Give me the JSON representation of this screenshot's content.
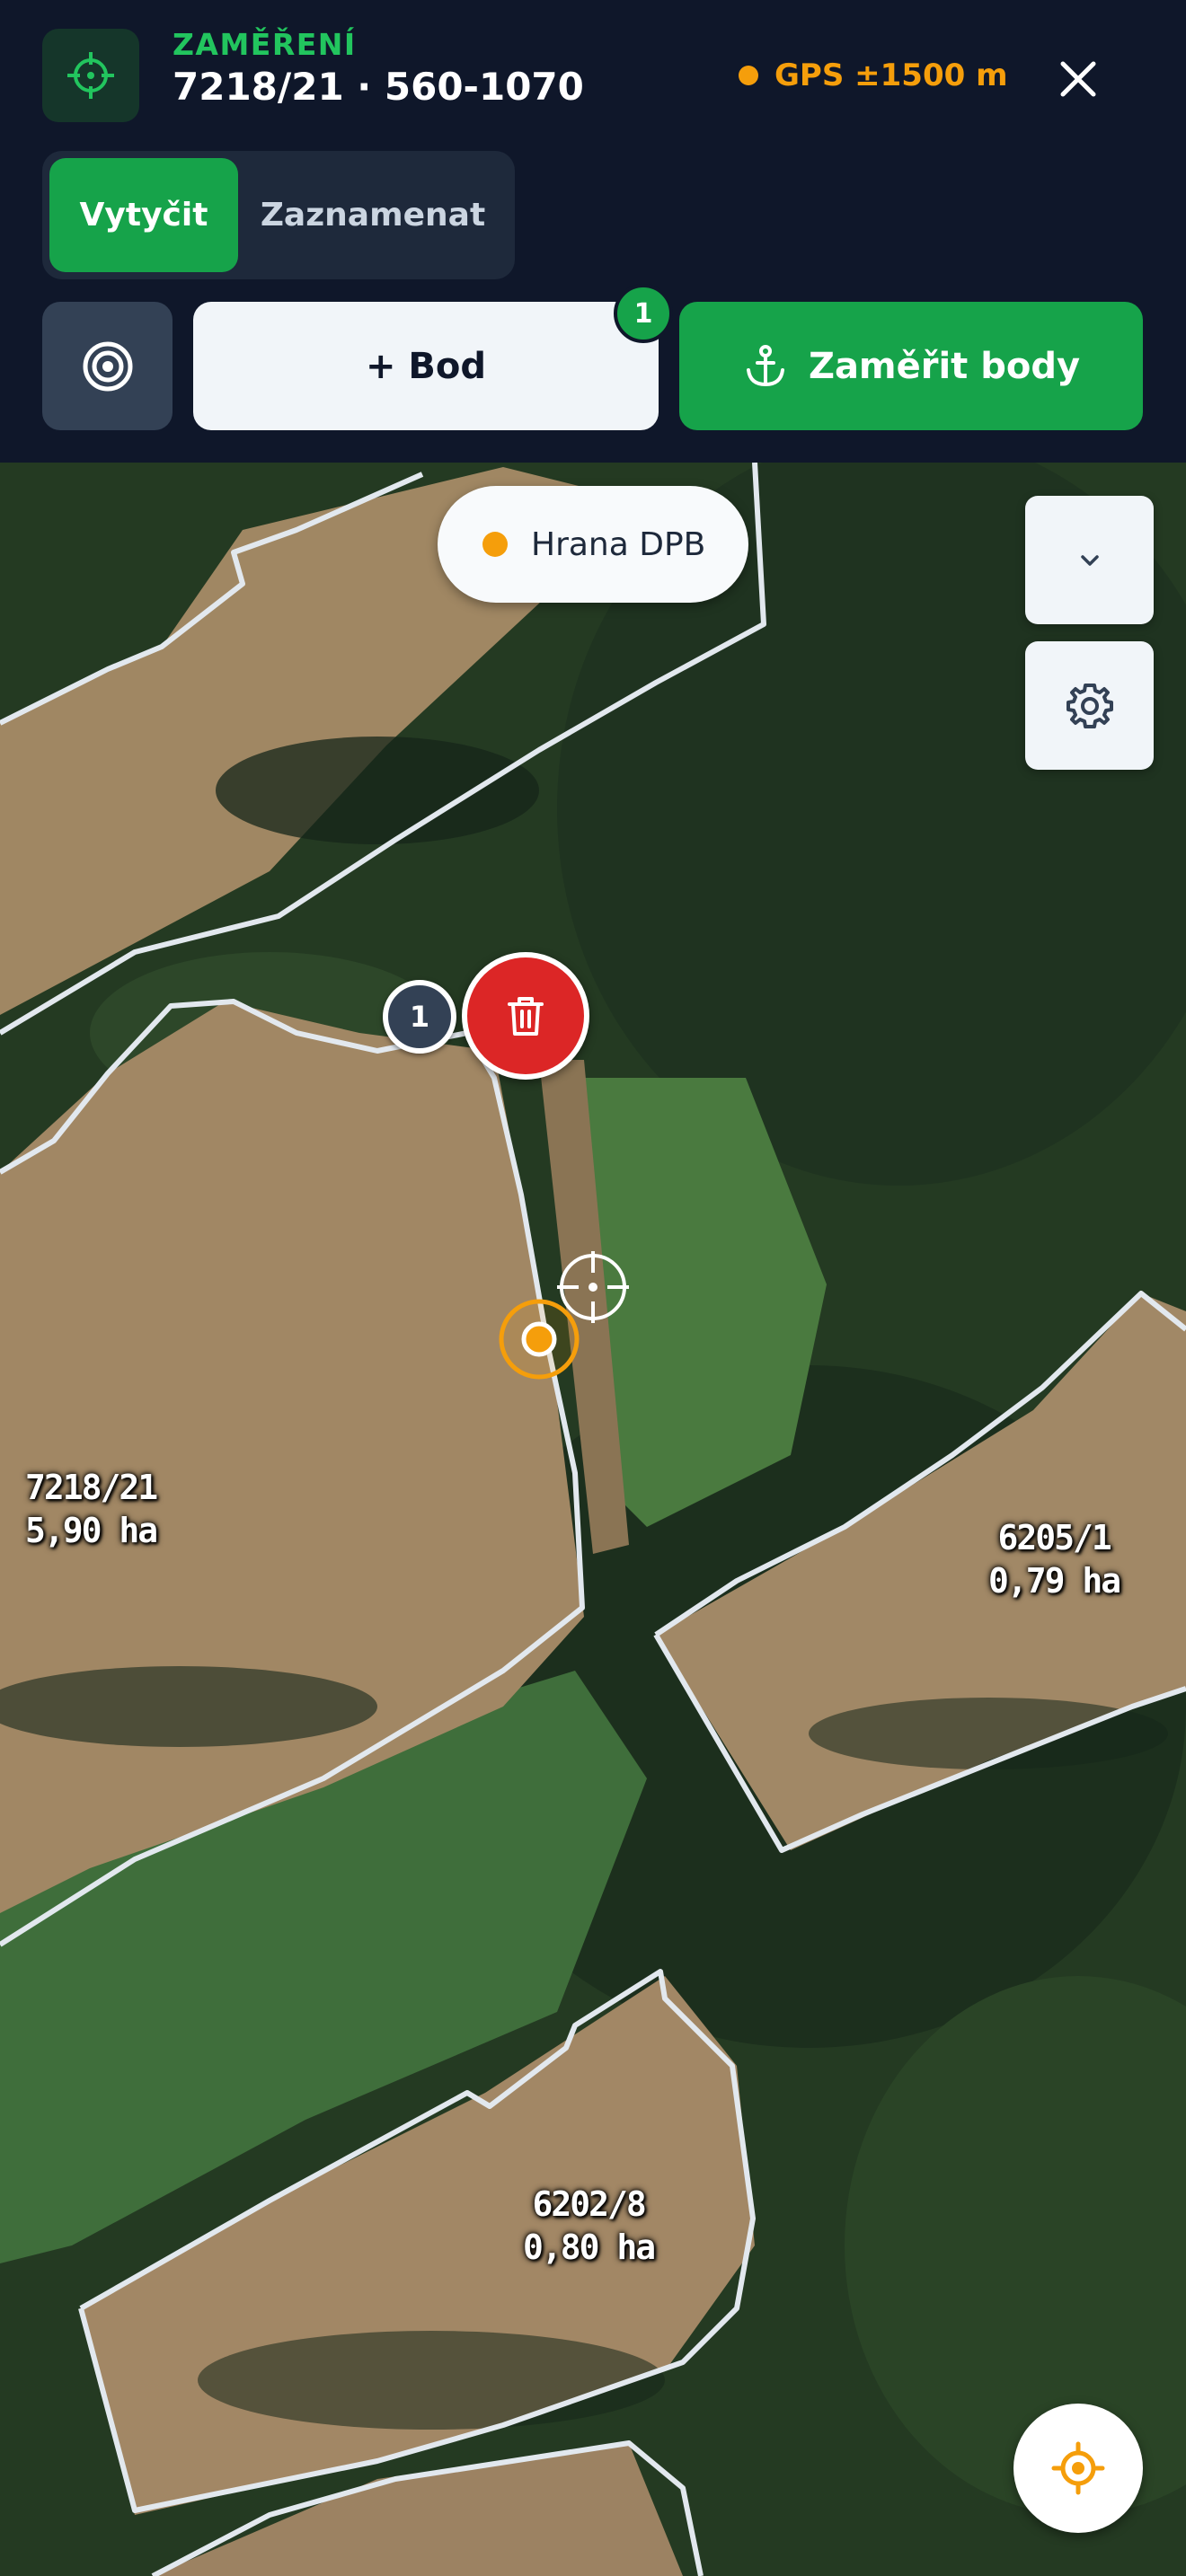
{
  "header": {
    "eyebrow": "ZAMĚŘENÍ",
    "title": "7218/21 · 560-1070",
    "gps_status": "GPS ±1500 m",
    "icons": {
      "app": "crosshair-icon",
      "close": "close-icon"
    }
  },
  "mode_tabs": [
    {
      "label": "Vytyčit",
      "active": true
    },
    {
      "label": "Zaznamenat",
      "active": false
    }
  ],
  "toolbar": {
    "target_icon": "target-icon",
    "add_point_label": "+ Bod",
    "add_point_badge": "1",
    "measure_label": "Zaměřit body",
    "measure_icon": "anchor-icon"
  },
  "map": {
    "legend_label": "Hrana DPB",
    "legend_color": "#f59e0b",
    "controls": {
      "collapse_icon": "chevron-down-icon",
      "settings_icon": "gear-icon",
      "locate_icon": "locate-icon"
    },
    "point_marker_label": "1",
    "delete_icon": "trash-icon",
    "parcels": [
      {
        "code": "7218/21",
        "area": "5,90 ha"
      },
      {
        "code": "6205/1",
        "area": "0,79 ha"
      },
      {
        "code": "6202/8",
        "area": "0,80 ha"
      }
    ]
  },
  "colors": {
    "accent_green": "#16a34a",
    "gps_amber": "#f59e0b",
    "danger_red": "#dc2626",
    "header_bg": "#0f172a"
  }
}
